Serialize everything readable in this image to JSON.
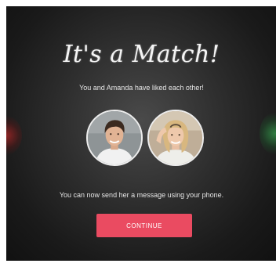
{
  "match": {
    "title": "It's a Match!",
    "subtitle": "You and Amanda have liked each other!",
    "message": "You can now send her a message using your phone.",
    "continue_label": "CONTINUE"
  },
  "colors": {
    "accent": "#ea4b61",
    "overlay": "#2c2c2c",
    "avatar_border": "#ededed"
  }
}
